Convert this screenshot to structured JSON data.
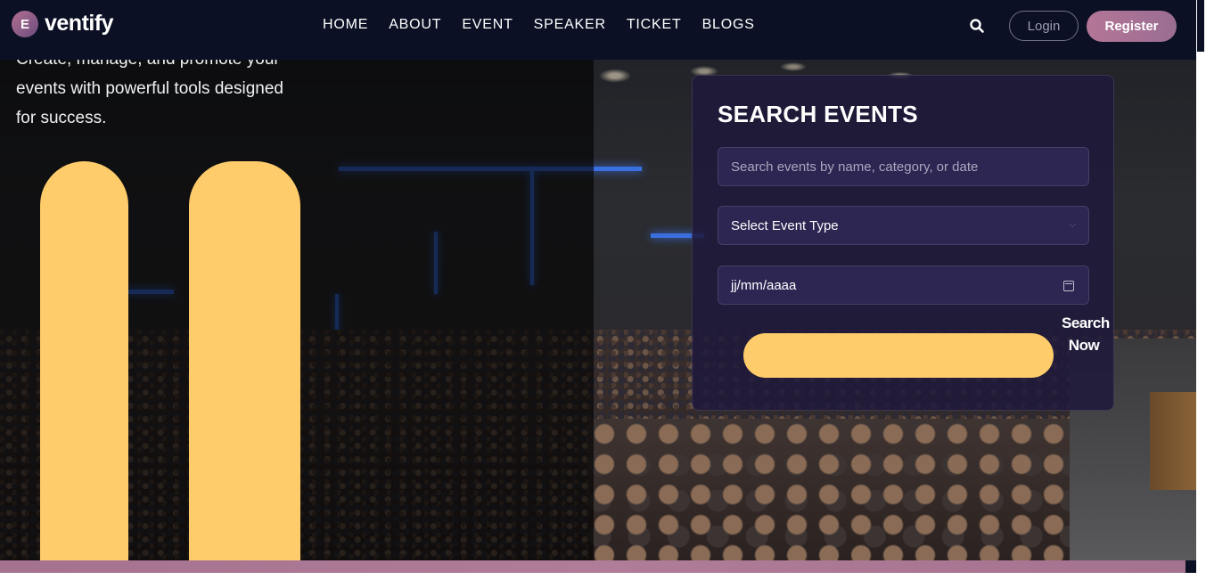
{
  "brand": {
    "badge": "E",
    "name": "ventify"
  },
  "nav": {
    "items": [
      {
        "label": "HOME"
      },
      {
        "label": "ABOUT"
      },
      {
        "label": "EVENT"
      },
      {
        "label": "SPEAKER"
      },
      {
        "label": "TICKET"
      },
      {
        "label": "BLOGS"
      }
    ],
    "login_label": "Login",
    "register_label": "Register"
  },
  "hero": {
    "line1": "Create, manage, and promote your",
    "line2": "events with powerful tools designed",
    "line3": "for success."
  },
  "search_card": {
    "title": "SEARCH EVENTS",
    "query_placeholder": "Search events by name, category, or date",
    "event_type_selected": "Select Event Type",
    "date_placeholder": "jj/mm/aaaa",
    "submit_label_1": "Search",
    "submit_label_2": "Now"
  },
  "colors": {
    "nav_bg": "#0b1024",
    "accent_yellow": "#ffcc6b",
    "register_bg": "#b47697",
    "card_bg": "#1e183a"
  }
}
